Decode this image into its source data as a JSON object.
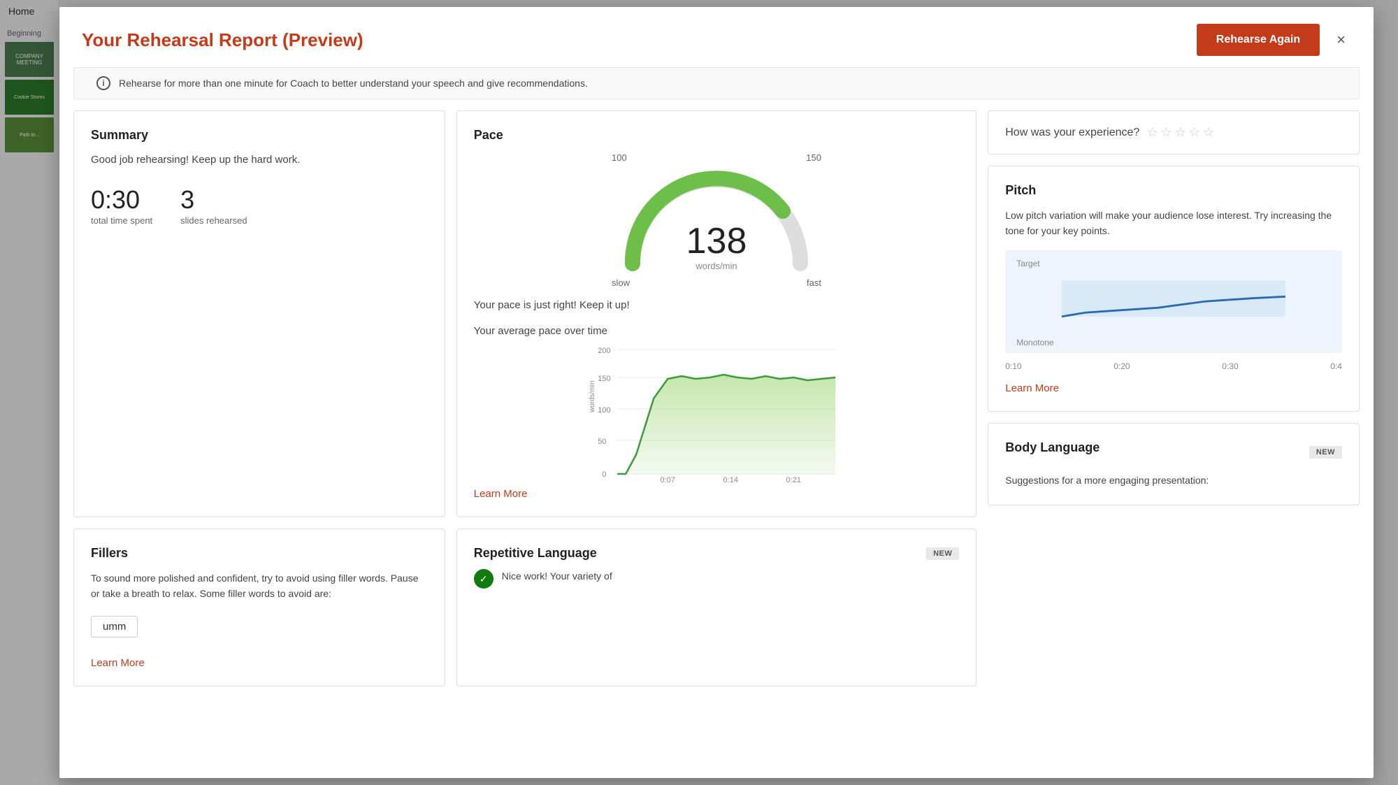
{
  "modal": {
    "title": "Your Rehearsal Report (Preview)",
    "rehearse_again_label": "Rehearse Again",
    "close_label": "×",
    "info_text": "Rehearse for more than one minute for Coach to better understand your speech and give recommendations."
  },
  "summary": {
    "card_title": "Summary",
    "message": "Good job rehearsing! Keep up the hard work.",
    "total_time": "0:30",
    "total_time_label": "total time spent",
    "slides_count": "3",
    "slides_label": "slides rehearsed"
  },
  "pace": {
    "card_title": "Pace",
    "speed_value": "138",
    "speed_unit": "words/min",
    "label_slow": "slow",
    "label_fast": "fast",
    "label_100": "100",
    "label_150": "150",
    "pace_message": "Your pace is just right! Keep it up!",
    "chart_title": "Your average pace over time",
    "chart_y_label": "words/min",
    "chart_y_200": "200",
    "chart_y_150": "150",
    "chart_y_100": "100",
    "chart_y_50": "50",
    "chart_y_0": "0",
    "chart_x_007": "0:07",
    "chart_x_014": "0:14",
    "chart_x_021": "0:21",
    "learn_more_label": "Learn More"
  },
  "experience": {
    "question": "How was your experience?"
  },
  "pitch": {
    "card_title": "Pitch",
    "description": "Low pitch variation will make your audience lose interest. Try increasing the tone for your key points.",
    "target_label": "Target",
    "monotone_label": "Monotone",
    "time_010": "0:10",
    "time_020": "0:20",
    "time_030": "0:30",
    "time_04x": "0:4",
    "learn_more_label": "Learn More"
  },
  "fillers": {
    "card_title": "Fillers",
    "description": "To sound more polished and confident, try to avoid using filler words. Pause or take a breath to relax. Some filler words to avoid are:",
    "filler_word": "umm",
    "learn_more_label": "Learn More"
  },
  "repetitive": {
    "card_title": "Repetitive Language",
    "new_badge": "NEW",
    "success_text": "Nice work! Your variety of"
  },
  "body_language": {
    "card_title": "Body Language",
    "new_badge": "NEW",
    "description": "Suggestions for a more engaging presentation:"
  }
}
